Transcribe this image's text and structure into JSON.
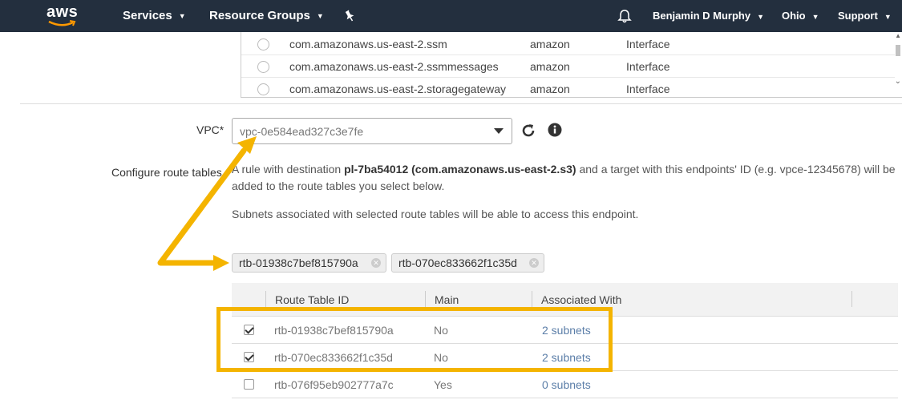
{
  "nav": {
    "logo_text": "aws",
    "services_label": "Services",
    "resource_groups_label": "Resource Groups",
    "user_label": "Benjamin D Murphy",
    "region_label": "Ohio",
    "support_label": "Support",
    "caret": "▼",
    "pin_icon": "pin-icon",
    "bell_icon": "bell-icon"
  },
  "endpoint_list": {
    "rows": [
      {
        "name": "com.amazonaws.us-east-2.ssm",
        "owner": "amazon",
        "type": "Interface"
      },
      {
        "name": "com.amazonaws.us-east-2.ssmmessages",
        "owner": "amazon",
        "type": "Interface"
      },
      {
        "name": "com.amazonaws.us-east-2.storagegateway",
        "owner": "amazon",
        "type": "Interface"
      }
    ]
  },
  "vpc": {
    "label": "VPC*",
    "value": "vpc-0e584ead327c3e7fe"
  },
  "route_tables": {
    "label": "Configure route tables",
    "desc_prefix": "A rule with destination ",
    "desc_bold": "pl-7ba54012 (com.amazonaws.us-east-2.s3)",
    "desc_suffix": " and a target with this endpoints' ID (e.g. vpce-12345678) will be added to the route tables you select below.",
    "note": "Subnets associated with selected route tables will be able to access this endpoint.",
    "selected_tags": [
      "rtb-01938c7bef815790a",
      "rtb-070ec833662f1c35d"
    ],
    "columns": [
      "Route Table ID",
      "Main",
      "Associated With"
    ],
    "rows": [
      {
        "id": "rtb-01938c7bef815790a",
        "main": "No",
        "assoc": "2 subnets",
        "checked": true
      },
      {
        "id": "rtb-070ec833662f1c35d",
        "main": "No",
        "assoc": "2 subnets",
        "checked": true
      },
      {
        "id": "rtb-076f95eb902777a7c",
        "main": "Yes",
        "assoc": "0 subnets",
        "checked": false
      }
    ]
  },
  "colors": {
    "nav_bg": "#232f3e",
    "annotation": "#f4b400",
    "link": "#5b7ea8",
    "aws_orange": "#ff9900"
  }
}
